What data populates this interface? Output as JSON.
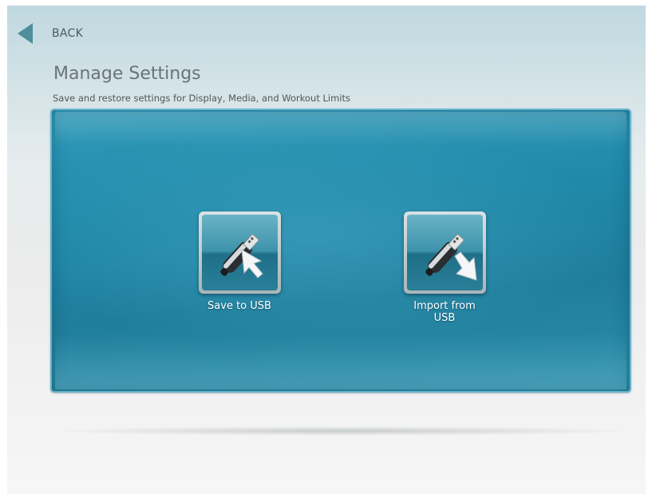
{
  "nav": {
    "back_label": "BACK"
  },
  "page": {
    "title": "Manage Settings",
    "subtitle": "Save and restore settings for Display, Media, and Workout Limits"
  },
  "actions": {
    "save": {
      "label": "Save to USB",
      "icon": "usb-save-icon"
    },
    "import": {
      "label": "Import from\nUSB",
      "icon": "usb-import-icon"
    }
  },
  "colors": {
    "accent": "#4e8e9d",
    "panel": "#2089a9",
    "label": "#ffffff"
  }
}
